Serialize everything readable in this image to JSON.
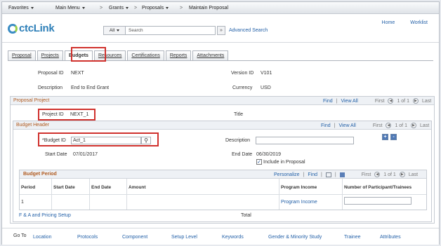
{
  "topnav": {
    "favorites": "Favorites",
    "main_menu": "Main Menu",
    "breadcrumb": [
      "Grants",
      "Proposals",
      "Maintain Proposal"
    ],
    "separator": ">"
  },
  "header": {
    "logo_text": "ctcLink",
    "search_scope": "All",
    "search_placeholder": "Search",
    "search_go": "»",
    "advanced_search": "Advanced Search",
    "home": "Home",
    "worklist": "Worklist"
  },
  "tabs": [
    "Proposal",
    "Projects",
    "Budgets",
    "Resources",
    "Certifications",
    "Reports",
    "Attachments"
  ],
  "active_tab": "Budgets",
  "summary": {
    "proposal_id_label": "Proposal ID",
    "proposal_id": "NEXT",
    "version_id_label": "Version ID",
    "version_id": "V101",
    "description_label": "Description",
    "description": "End to End Grant",
    "currency_label": "Currency",
    "currency": "USD"
  },
  "proposal_project": {
    "title": "Proposal Project",
    "find": "Find",
    "view_all": "View All",
    "first": "First",
    "counter": "1 of 1",
    "last": "Last",
    "project_id_label": "Project ID",
    "project_id": "NEXT_1",
    "title_label": "Title",
    "title_value": ""
  },
  "budget_header": {
    "title": "Budget Header",
    "find": "Find",
    "view_all": "View All",
    "first": "First",
    "counter": "1 of 1",
    "last": "Last",
    "budget_id_label": "*Budget ID",
    "budget_id": "Act_1",
    "description_label": "Description",
    "description": "",
    "start_date_label": "Start Date",
    "start_date": "07/01/2017",
    "end_date_label": "End Date",
    "end_date": "06/30/2019",
    "include_label": "Include in Proposal",
    "include_checked": true,
    "add_btn": "+",
    "remove_btn": "-"
  },
  "budget_period": {
    "title": "Budget Period",
    "personalize": "Personalize",
    "find": "Find",
    "first": "First",
    "counter": "1 of 1",
    "last": "Last",
    "columns": [
      "Period",
      "Start Date",
      "End Date",
      "Amount",
      "Program Income",
      "Number of Participant/Trainees"
    ],
    "row": {
      "period": "1",
      "start_date": "",
      "end_date": "",
      "amount": "",
      "program_income": "Program Income",
      "participants": ""
    }
  },
  "footer_row": {
    "fa_link": "F & A and Pricing Setup",
    "total_label": "Total"
  },
  "goto": {
    "label": "Go To",
    "items": [
      "Location",
      "Protocols",
      "Component",
      "Setup Level",
      "Keywords",
      "Gender & Minority Study",
      "Trainee",
      "Attributes"
    ]
  },
  "colors": {
    "highlight": "#d0312d",
    "link": "#2461a8",
    "section_title": "#b05a1f"
  }
}
